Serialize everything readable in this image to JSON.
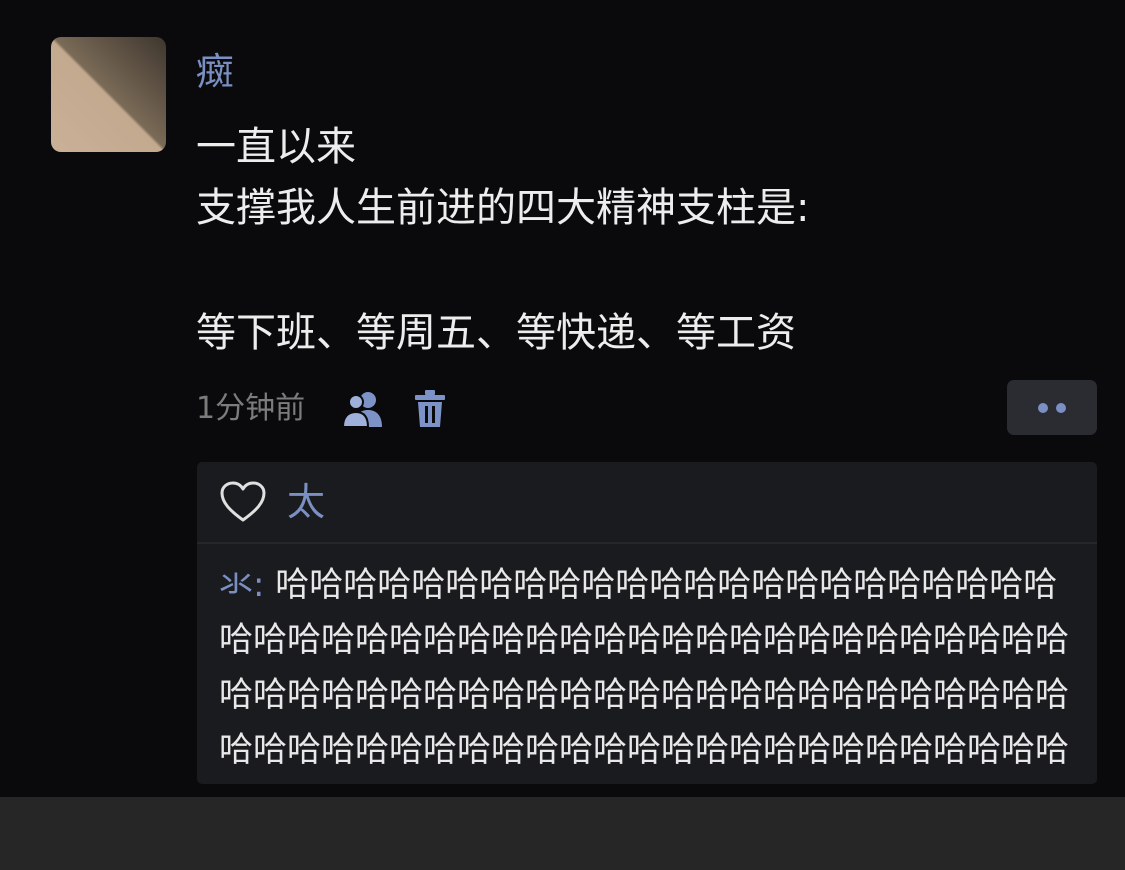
{
  "post": {
    "username": "癍",
    "text_lines": [
      "一直以来",
      "支撑我人生前进的四大精神支柱是:",
      "等下班、等周五、等快递、等工资"
    ],
    "time": "1分钟前",
    "icons": {
      "avatar": "avatar-image",
      "visibility": "people-icon",
      "delete": "trash-icon",
      "more": "more-dots-icon"
    }
  },
  "interactions": {
    "like_icon": "heart-icon",
    "liker": "太",
    "comment": {
      "author": "氺",
      "separator": ": ",
      "text": "哈哈哈哈哈哈哈哈哈哈哈哈哈哈哈哈哈哈哈哈哈哈哈哈哈哈哈哈哈哈哈哈哈哈哈哈哈哈哈哈哈哈哈哈哈哈哈哈哈哈哈哈哈哈哈哈哈哈哈哈哈哈哈哈哈哈哈哈哈哈哈哈哈哈哈哈哈哈哈哈哈哈哈哈哈哈哈哈哈哈哈哈哈哈哈哈哈哈哈"
    }
  },
  "colors": {
    "background": "#0a0a0c",
    "name_blue": "#7b8fc3",
    "text": "#ededed",
    "meta_gray": "#7c7c7c",
    "comment_box": "#1a1b1e"
  }
}
